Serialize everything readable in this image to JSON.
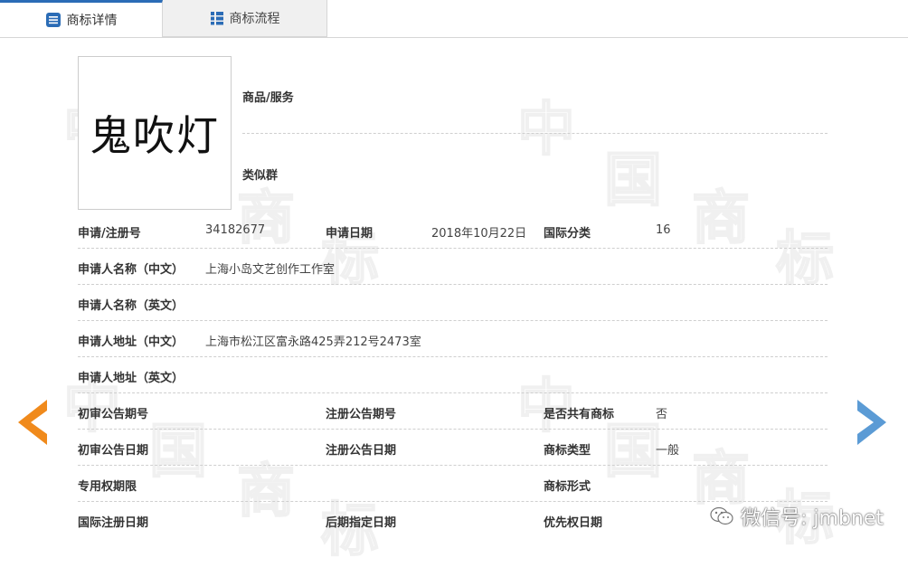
{
  "tabs": [
    {
      "label": "商标详情",
      "active": true
    },
    {
      "label": "商标流程",
      "active": false
    }
  ],
  "watermark_chars": [
    "中",
    "国",
    "商",
    "标"
  ],
  "logo": {
    "text": "鬼吹灯"
  },
  "side_fields": {
    "goods_services_label": "商品/服务",
    "similar_group_label": "类似群"
  },
  "rows": [
    {
      "cells": [
        {
          "label": "申请/注册号",
          "value": "34182677"
        },
        {
          "label": "申请日期",
          "value": "2018年10月22日"
        },
        {
          "label": "国际分类",
          "value": "16"
        }
      ]
    },
    {
      "cells": [
        {
          "label": "申请人名称（中文）",
          "value": "上海小岛文艺创作工作室"
        }
      ]
    },
    {
      "cells": [
        {
          "label": "申请人名称（英文）",
          "value": ""
        }
      ]
    },
    {
      "cells": [
        {
          "label": "申请人地址（中文）",
          "value": "上海市松江区富永路425弄212号2473室"
        }
      ]
    },
    {
      "cells": [
        {
          "label": "申请人地址（英文）",
          "value": ""
        }
      ]
    },
    {
      "cells": [
        {
          "label": "初审公告期号",
          "value": ""
        },
        {
          "label": "注册公告期号",
          "value": ""
        },
        {
          "label": "是否共有商标",
          "value": "否"
        }
      ]
    },
    {
      "cells": [
        {
          "label": "初审公告日期",
          "value": ""
        },
        {
          "label": "注册公告日期",
          "value": ""
        },
        {
          "label": "商标类型",
          "value": "一般"
        }
      ]
    },
    {
      "cells": [
        {
          "label": "专用权期限",
          "value": ""
        },
        {
          "label": "",
          "value": ""
        },
        {
          "label": "商标形式",
          "value": ""
        }
      ]
    },
    {
      "cells": [
        {
          "label": "国际注册日期",
          "value": ""
        },
        {
          "label": "后期指定日期",
          "value": ""
        },
        {
          "label": "优先权日期",
          "value": ""
        }
      ]
    }
  ],
  "nav": {
    "prev_icon": "arrow-left-icon",
    "next_icon": "arrow-right-icon"
  },
  "wechat_watermark": {
    "text": "微信号: jmbnet"
  },
  "colors": {
    "accent": "#2b6cb6",
    "prev_arrow": "#f08a1c",
    "next_arrow": "#5b9bd5"
  }
}
